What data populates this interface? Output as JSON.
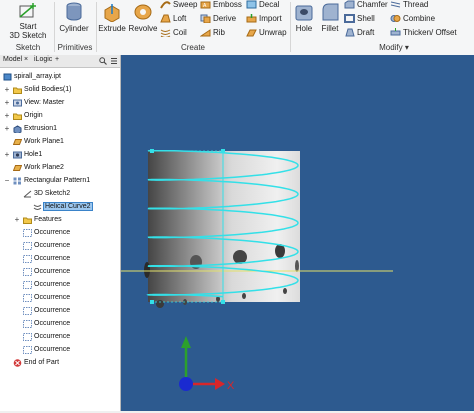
{
  "ribbon": {
    "sketch": {
      "start_line1": "Start",
      "start_line2": "3D Sketch",
      "panel": "Sketch"
    },
    "primitives": {
      "cylinder": "Cylinder",
      "panel": "Primitives"
    },
    "create": {
      "extrude": "Extrude",
      "revolve": "Revolve",
      "sweep": "Sweep",
      "loft": "Loft",
      "coil": "Coil",
      "emboss": "Emboss",
      "derive": "Derive",
      "rib": "Rib",
      "decal": "Decal",
      "import": "Import",
      "unwrap": "Unwrap",
      "panel": "Create"
    },
    "modify": {
      "hole": "Hole",
      "fillet": "Fillet",
      "chamfer": "Chamfer",
      "shell": "Shell",
      "draft": "Draft",
      "thread": "Thread",
      "combine": "Combine",
      "thicken": "Thicken/ Offset",
      "panel": "Modify"
    }
  },
  "browser": {
    "tabs": {
      "model": "Model",
      "close": "×",
      "ilogic": "iLogic",
      "add": "+"
    },
    "tree": [
      {
        "label": "spirall_array.ipt",
        "icon": "part-icon"
      },
      {
        "label": "Solid Bodies(1)",
        "icon": "folder-icon"
      },
      {
        "label": "View: Master",
        "icon": "view-icon"
      },
      {
        "label": "Origin",
        "icon": "folder-icon"
      },
      {
        "label": "Extrusion1",
        "icon": "extrude-icon"
      },
      {
        "label": "Work Plane1",
        "icon": "workplane-icon"
      },
      {
        "label": "Hole1",
        "icon": "hole-icon"
      },
      {
        "label": "Work Plane2",
        "icon": "workplane-icon"
      },
      {
        "label": "Rectangular Pattern1",
        "icon": "pattern-icon"
      },
      {
        "label": "3D Sketch2",
        "icon": "sketch-icon"
      },
      {
        "label": "Helical Curve2",
        "icon": "curve-icon"
      },
      {
        "label": "Features",
        "icon": "folder-icon"
      },
      {
        "label": "Occurrence",
        "icon": "occurrence-icon"
      },
      {
        "label": "Occurrence",
        "icon": "occurrence-icon"
      },
      {
        "label": "Occurrence",
        "icon": "occurrence-icon"
      },
      {
        "label": "Occurrence",
        "icon": "occurrence-icon"
      },
      {
        "label": "Occurrence",
        "icon": "occurrence-icon"
      },
      {
        "label": "Occurrence",
        "icon": "occurrence-icon"
      },
      {
        "label": "Occurrence",
        "icon": "occurrence-icon"
      },
      {
        "label": "Occurrence",
        "icon": "occurrence-icon"
      },
      {
        "label": "Occurrence",
        "icon": "occurrence-icon"
      },
      {
        "label": "Occurrence",
        "icon": "occurrence-icon"
      },
      {
        "label": "End of Part",
        "icon": "end-of-part-icon"
      }
    ]
  },
  "viewport": {
    "triad": {
      "x_label": "X"
    },
    "colors": {
      "background": "#2d5a8f",
      "helix": "#33e0e8",
      "x_axis": "#d8262a",
      "y_axis": "#2ca02c",
      "z_axis": "#1a2ad0"
    }
  }
}
